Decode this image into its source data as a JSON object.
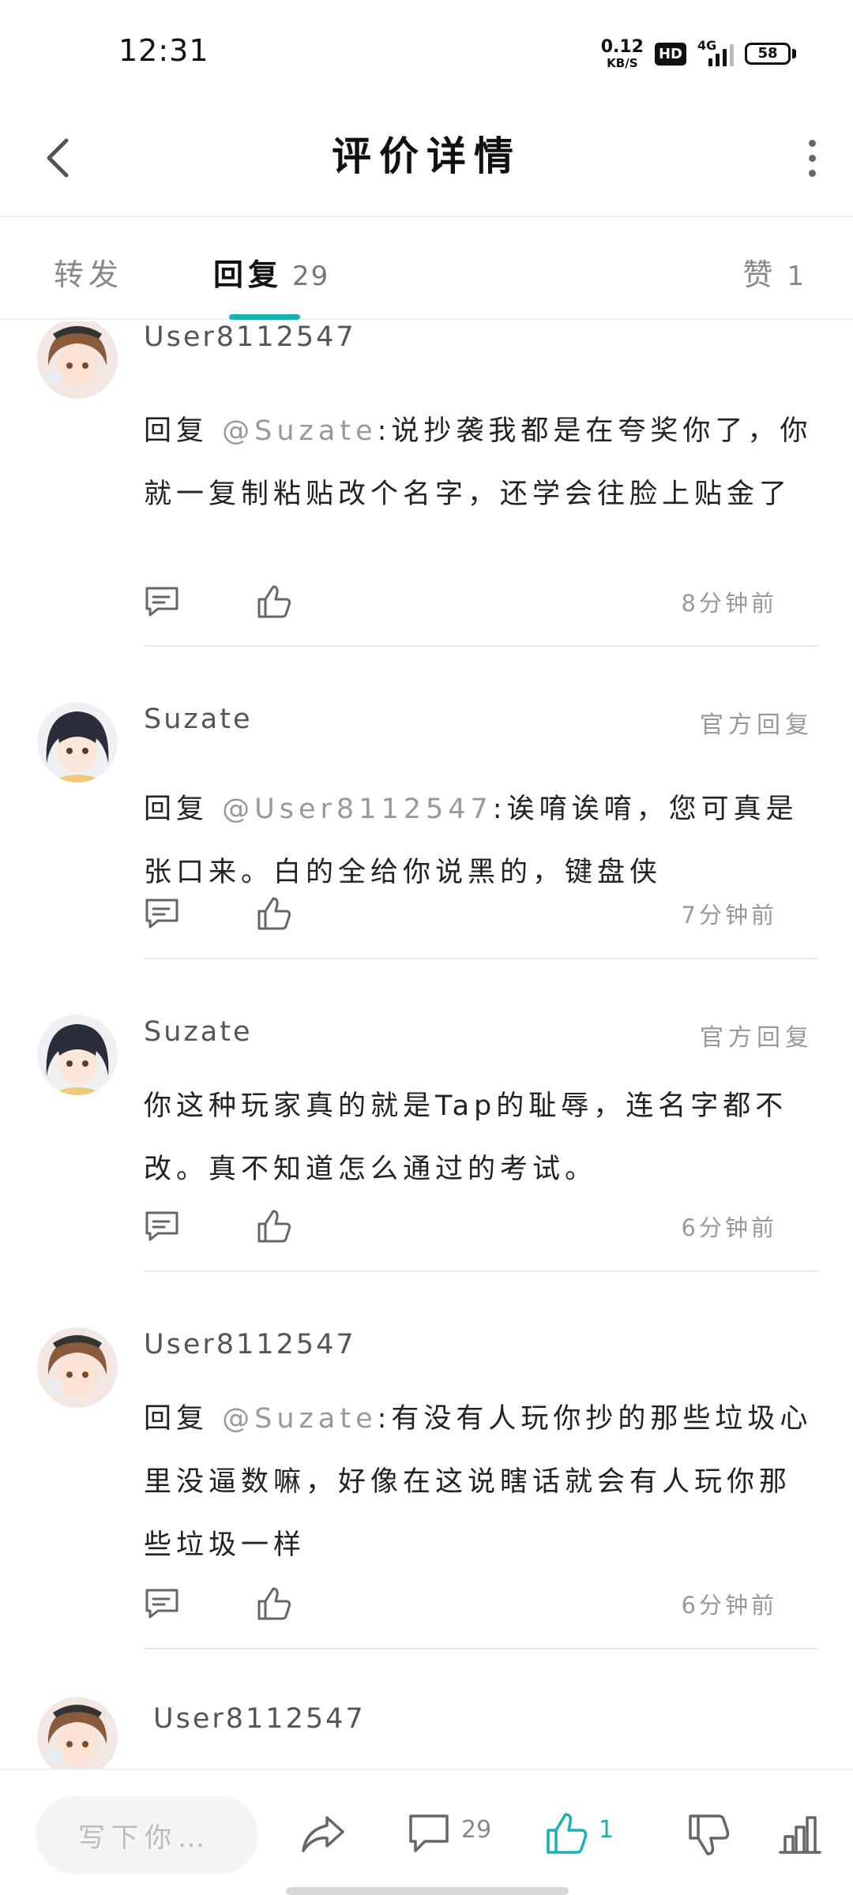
{
  "status": {
    "time": "12:31",
    "net_speed_value": "0.12",
    "net_speed_unit": "KB/S",
    "hd_label": "HD",
    "network_label": "4G",
    "battery": "58"
  },
  "header": {
    "title": "评价详情"
  },
  "tabs": {
    "repost": "转发",
    "reply": "回复",
    "reply_count": "29",
    "like": "赞",
    "like_count": "1"
  },
  "replies": [
    {
      "user": "User8112547",
      "prefix": "回复 ",
      "mention": "@Suzate",
      "text": ":说抄袭我都是在夸奖你了，你就一复制粘贴改个名字，还学会往脸上贴金了",
      "time": "8分钟前"
    },
    {
      "user": "Suzate",
      "official": "官方回复",
      "prefix": "回复 ",
      "mention": "@User8112547",
      "text": ":诶唷诶唷，您可真是张口来。白的全给你说黑的，键盘侠",
      "time": "7分钟前"
    },
    {
      "user": "Suzate",
      "official": "官方回复",
      "text": "你这种玩家真的就是Tap的耻辱，连名字都不改。真不知道怎么通过的考试。",
      "time": "6分钟前"
    },
    {
      "user": "User8112547",
      "prefix": "回复 ",
      "mention": "@Suzate",
      "text": ":有没有人玩你抄的那些垃圾心里没逼数嘛，好像在这说瞎话就会有人玩你那些垃圾一样",
      "time": "6分钟前"
    },
    {
      "user": "User8112547"
    }
  ],
  "bottom_bar": {
    "input_placeholder": "写下你…",
    "comment_count": "29",
    "like_count": "1"
  },
  "colors": {
    "accent": "#19b1b5",
    "muted_text": "#999999",
    "primary_text": "#222222"
  },
  "icons": [
    "back-icon",
    "more-icon",
    "comment-icon",
    "like-icon",
    "share-icon",
    "dislike-icon",
    "chart-icon"
  ]
}
